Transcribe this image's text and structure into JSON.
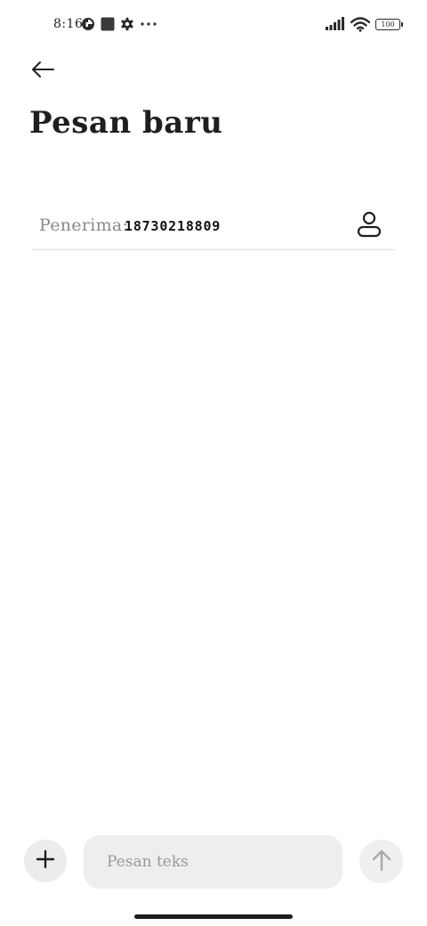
{
  "status_bar": {
    "time": "8:16",
    "left_icons": [
      "data-saver-icon",
      "app-notification-icon",
      "settings-gear-icon",
      "more-dots-icon"
    ],
    "right_icons": [
      "signal-bars-icon",
      "wifi-icon",
      "battery-icon"
    ],
    "battery_level": "100"
  },
  "header": {
    "back_icon": "arrow-left-icon",
    "title": "Pesan baru"
  },
  "recipient": {
    "label": "Penerima:",
    "value": "18730218809",
    "contact_icon": "person-icon"
  },
  "composer": {
    "add_icon": "plus-icon",
    "placeholder": "Pesan teks",
    "value": "",
    "send_icon": "arrow-up-icon"
  },
  "colors": {
    "background": "#ffffff",
    "text": "#1f1f1f",
    "label_gray": "#8a8a8a",
    "field_bg": "#eeeeee",
    "divider": "#dcdcdc"
  }
}
